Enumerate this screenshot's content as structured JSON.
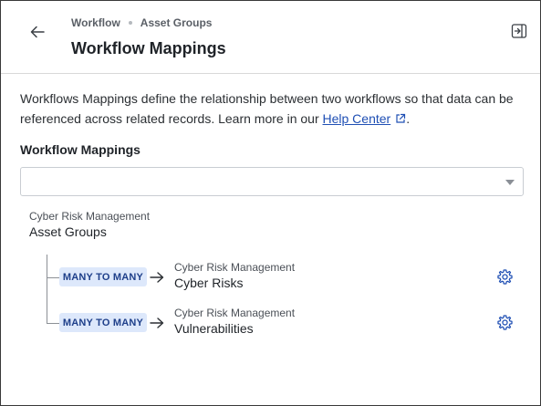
{
  "header": {
    "breadcrumb": [
      "Workflow",
      "Asset Groups"
    ],
    "title": "Workflow Mappings"
  },
  "description": {
    "text": "Workflows Mappings define the relationship between two workflows so that data can be referenced across related records. Learn more in our ",
    "link_label": "Help Center",
    "suffix": "."
  },
  "mappings_section": {
    "label": "Workflow Mappings",
    "select_value": ""
  },
  "source": {
    "workspace": "Cyber Risk Management",
    "workflow": "Asset Groups"
  },
  "relations": [
    {
      "type": "MANY TO MANY",
      "workspace": "Cyber Risk Management",
      "workflow": "Cyber Risks"
    },
    {
      "type": "MANY TO MANY",
      "workspace": "Cyber Risk Management",
      "workflow": "Vulnerabilities"
    }
  ],
  "colors": {
    "accent": "#1f4fb4",
    "badge_bg": "#dde8fb",
    "badge_text": "#1e3f8a"
  },
  "icons": {
    "back": "arrow-left-icon",
    "collapse": "panel-collapse-icon",
    "external": "external-link-icon",
    "relation_arrow": "arrow-right-icon",
    "settings": "gear-icon"
  }
}
